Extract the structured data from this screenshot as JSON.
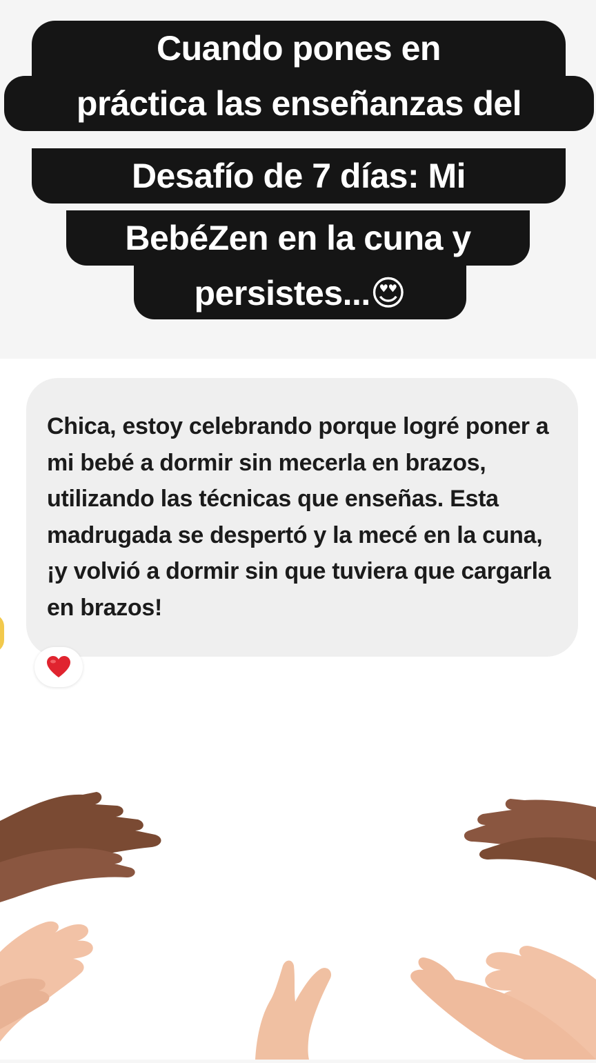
{
  "caption": {
    "lines": [
      "Cuando pones en",
      "práctica las enseñanzas del",
      "Desafío de 7 días: Mi",
      "BebéZen en la cuna y",
      "persistes...😍"
    ]
  },
  "message": {
    "text": "Chica, estoy celebrando porque logré poner a mi bebé a dormir sin mecerla en brazos, utilizando las técnicas que enseñas. Esta madrugada se despertó y la mecé en la cuna, ¡y volvió a dormir sin que tuviera que cargarla en brazos!",
    "reaction": "❤️"
  },
  "colors": {
    "caption_bg": "#151515",
    "caption_text": "#ffffff",
    "bubble_bg": "#efefef",
    "text": "#1b1b1b",
    "heart": "#e0242f",
    "skin_dark": "#7a4a33",
    "skin_light": "#f2c2a6"
  },
  "icons": [
    "heart-icon",
    "clapping-hands-icon"
  ]
}
